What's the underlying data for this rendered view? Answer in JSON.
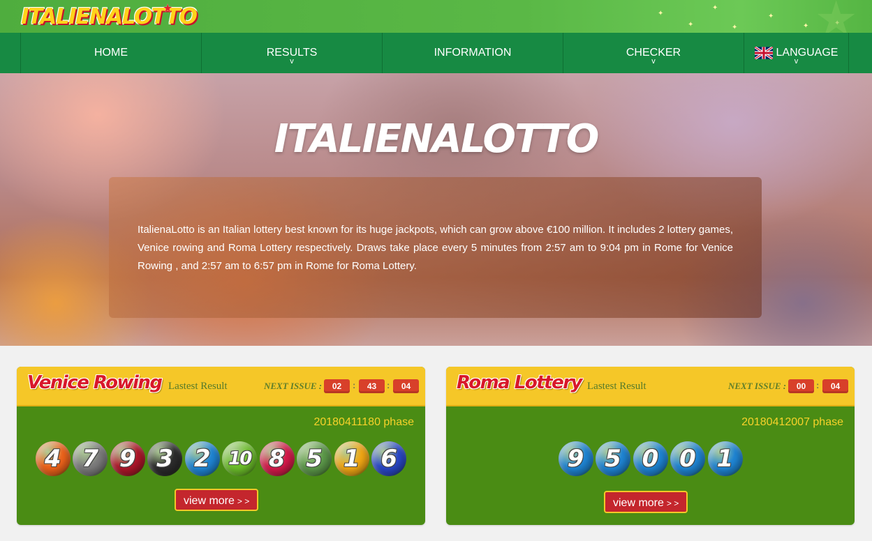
{
  "header": {
    "logo_text": "ITALIENALOTTO"
  },
  "nav": {
    "items": [
      {
        "label": "HOME",
        "has_dropdown": false
      },
      {
        "label": "RESULTS",
        "has_dropdown": true
      },
      {
        "label": "INFORMATION",
        "has_dropdown": false
      },
      {
        "label": "CHECKER",
        "has_dropdown": true
      },
      {
        "label": "LANGUAGE",
        "has_dropdown": true,
        "icon": "uk-flag-icon"
      }
    ],
    "dropdown_glyph": "v"
  },
  "hero": {
    "title": "ITALIENALOTTO",
    "description": "ItalienaLotto is an Italian lottery best known for its huge jackpots, which can grow above €100 million. It includes 2 lottery games, Venice rowing and Roma Lottery respectively. Draws take place every 5 minutes from 2:57 am to 9:04 pm in Rome for Venice Rowing , and 2:57 am to 6:57 pm in Rome for Roma Lottery."
  },
  "games": [
    {
      "title": "Venice Rowing",
      "subtitle": "Lastest Result",
      "next_issue_label": "NEXT ISSUE :",
      "countdown": [
        "02",
        "43",
        "04"
      ],
      "phase": "20180411180 phase",
      "numbers": [
        "4",
        "7",
        "9",
        "3",
        "2",
        "10",
        "8",
        "5",
        "1",
        "6"
      ],
      "ball_colors": [
        "#f0641b",
        "#7d7d7d",
        "#b0172a",
        "#2c2c2c",
        "#1f86d6",
        "#6dc02a",
        "#d81a4b",
        "#5d9a4a",
        "#f3a814",
        "#2a48c9"
      ],
      "view_more_label": "view more",
      "view_more_arrow": "> >"
    },
    {
      "title": "Roma Lottery",
      "subtitle": "Lastest Result",
      "next_issue_label": "NEXT ISSUE :",
      "countdown": [
        "00",
        "04"
      ],
      "phase": "20180412007 phase",
      "numbers": [
        "9",
        "5",
        "0",
        "0",
        "1"
      ],
      "ball_colors": [
        "#1f86d6",
        "#1f86d6",
        "#1f86d6",
        "#1f86d6",
        "#1f86d6"
      ],
      "view_more_label": "view more",
      "view_more_arrow": "> >"
    }
  ],
  "colors": {
    "nav_green": "#178a43",
    "card_green": "#4a8c14",
    "card_header_yellow": "#f5c728",
    "accent_red": "#c4262d"
  }
}
